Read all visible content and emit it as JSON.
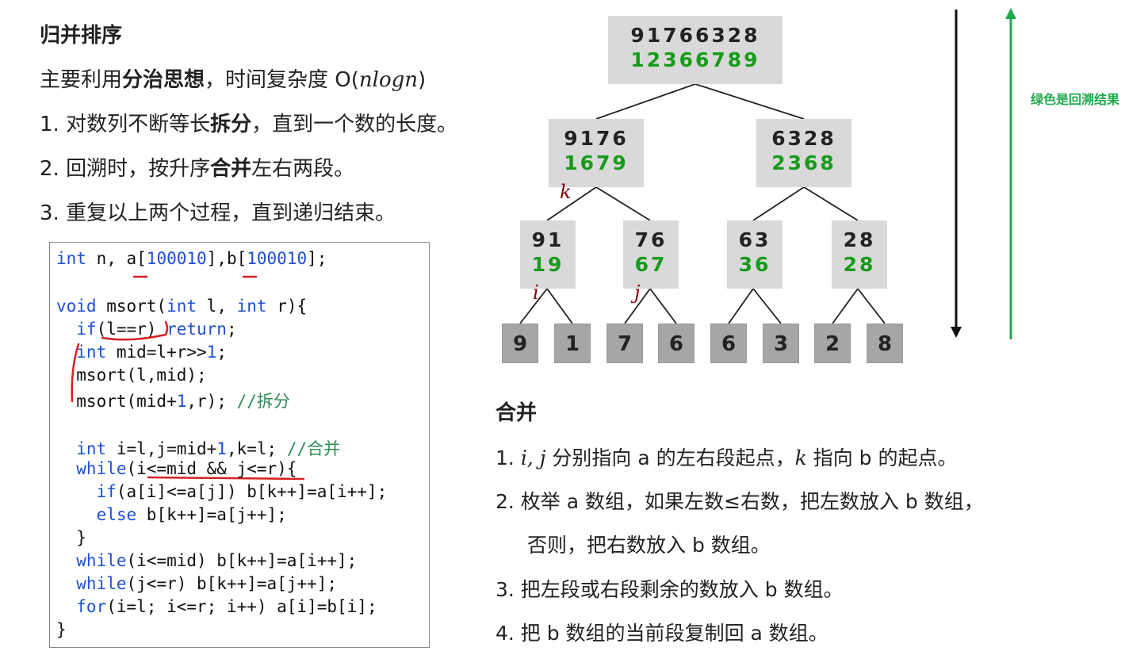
{
  "left": {
    "title": "归并排序",
    "intro_a": "主要利用",
    "intro_b": "分治思想",
    "intro_c": "，时间复杂度 O(",
    "intro_d": "nlogn",
    "intro_e": ")",
    "step1_a": "1.  对数列不断等长",
    "step1_b": "拆分",
    "step1_c": "，直到一个数的长度。",
    "step2_a": "2.  回溯时，按升序",
    "step2_b": "合并",
    "step2_c": "左右两段。",
    "step3": "3.  重复以上两个过程，直到递归结束。"
  },
  "code": {
    "l1a": "int",
    "l1b": " n, a[",
    "l1c": "100010",
    "l1d": "],b[",
    "l1e": "100010",
    "l1f": "];",
    "l2a": "void",
    "l2b": " msort(",
    "l2c": "int",
    "l2d": " l, ",
    "l2e": "int",
    "l2f": " r){",
    "l3a": "  if",
    "l3b": "(l==r) ",
    "l3c": "return",
    "l3d": ";",
    "l4a": "  int",
    "l4b": " mid=l+r>>",
    "l4c": "1",
    "l4d": ";",
    "l5": "  msort(l,mid);",
    "l6a": "  msort(mid+",
    "l6b": "1",
    "l6c": ",r); ",
    "l6d": "//拆分",
    "l7a": "  int",
    "l7b": " i=l,j=mid+",
    "l7c": "1",
    "l7d": ",k=l; ",
    "l7e": "//合并",
    "l8a": "  while",
    "l8b": "(i<=mid && j<=r){",
    "l9a": "    if",
    "l9b": "(a[i]<=a[j]) b[k++]=a[i++];",
    "l10a": "    else",
    "l10b": " b[k++]=a[j++];",
    "l11": "  }",
    "l12a": "  while",
    "l12b": "(i<=mid) b[k++]=a[i++];",
    "l13a": "  while",
    "l13b": "(j<=r) b[k++]=a[j++];",
    "l14a": "  for",
    "l14b": "(i=l; i<=r; i++) a[i]=b[i];",
    "l15": "}"
  },
  "tree": {
    "root": {
      "top": "91766328",
      "bot": "12366789"
    },
    "l1": [
      {
        "top": "9176",
        "bot": "1679"
      },
      {
        "top": "6328",
        "bot": "2368"
      }
    ],
    "l2": [
      {
        "top": "91",
        "bot": "19"
      },
      {
        "top": "76",
        "bot": "67"
      },
      {
        "top": "63",
        "bot": "36"
      },
      {
        "top": "28",
        "bot": "28"
      }
    ],
    "leaves": [
      "9",
      "1",
      "7",
      "6",
      "6",
      "3",
      "2",
      "8"
    ],
    "var_k": "k",
    "var_i": "i",
    "var_j": "j"
  },
  "green_note": "绿色是回溯结果",
  "merge": {
    "title": "合并",
    "m1_a": "1.  ",
    "m1_b": "i, j",
    "m1_c": " 分别指向 a 的左右段起点，",
    "m1_d": "k",
    "m1_e": " 指向 b 的起点。",
    "m2": "2.  枚举 a 数组，如果左数≤右数，把左数放入 b 数组，",
    "m2b": "否则，把右数放入 b 数组。",
    "m3": "3.  把左段或右段剩余的数放入 b 数组。",
    "m4": "4.  把 b 数组的当前段复制回 a 数组。"
  },
  "colors": {
    "green": "#169b1a",
    "arrow_green": "#22a94b",
    "var_red": "#8b0000",
    "keyword_blue": "#1f4fd6"
  }
}
